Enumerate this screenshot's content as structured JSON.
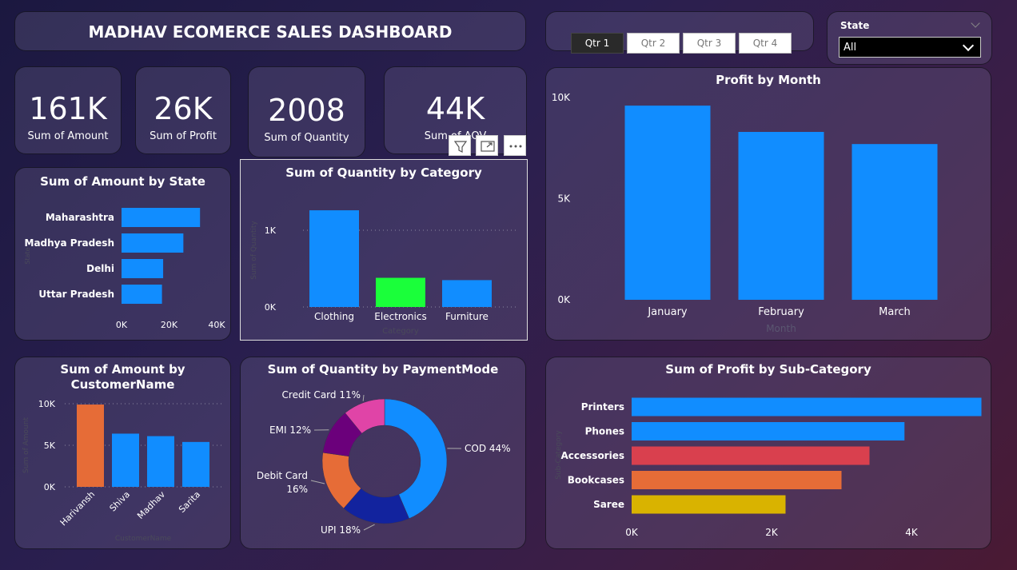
{
  "header": {
    "title": "MADHAV ECOMERCE SALES DASHBOARD"
  },
  "quarters": {
    "items": [
      "Qtr 1",
      "Qtr 2",
      "Qtr 3",
      "Qtr 4"
    ],
    "selected": "Qtr 1"
  },
  "state_filter": {
    "label": "State",
    "value": "All"
  },
  "kpis": [
    {
      "value": "161K",
      "label": "Sum of Amount"
    },
    {
      "value": "26K",
      "label": "Sum of Profit"
    },
    {
      "value": "2008",
      "label": "Sum of Quantity"
    },
    {
      "value": "44K",
      "label": "Sum of AOV"
    }
  ],
  "colors": {
    "blue": "#118DFF",
    "green": "#1AFF3A",
    "orange": "#E66C37",
    "red": "#D9404E",
    "yellow": "#D9B300",
    "navy": "#12239E",
    "purple": "#6B007B",
    "pink": "#E044A7"
  },
  "chart_data": [
    {
      "id": "amount_by_state",
      "type": "bar",
      "orientation": "horizontal",
      "title": "Sum of Amount by State",
      "ylabel": "State",
      "xlabel": "",
      "categories": [
        "Maharashtra",
        "Madhya Pradesh",
        "Delhi",
        "Uttar Pradesh"
      ],
      "values": [
        33000,
        26000,
        17500,
        17000
      ],
      "xlim": [
        0,
        40000
      ],
      "xticks": [
        "0K",
        "20K",
        "40K"
      ]
    },
    {
      "id": "quantity_by_category",
      "type": "bar",
      "title": "Sum of Quantity by Category",
      "xlabel": "Category",
      "ylabel": "Sum of Quantity",
      "categories": [
        "Clothing",
        "Electronics",
        "Furniture"
      ],
      "values": [
        1260,
        380,
        350
      ],
      "bar_colors": [
        "#118DFF",
        "#1AFF3A",
        "#118DFF"
      ],
      "ylim": [
        0,
        1000
      ],
      "yticks": [
        "0K",
        "1K"
      ]
    },
    {
      "id": "profit_by_month",
      "type": "bar",
      "title": "Profit by Month",
      "xlabel": "Month",
      "ylabel": "",
      "categories": [
        "January",
        "February",
        "March"
      ],
      "values": [
        9600,
        8300,
        7700
      ],
      "ylim": [
        0,
        10000
      ],
      "yticks": [
        "0K",
        "5K",
        "10K"
      ]
    },
    {
      "id": "amount_by_customer",
      "type": "bar",
      "title_lines": [
        "Sum of Amount by",
        "CustomerName"
      ],
      "xlabel": "CustomerName",
      "ylabel": "Sum of Amount",
      "categories": [
        "Harivansh",
        "Shiva",
        "Madhav",
        "Sarita"
      ],
      "values": [
        9900,
        6400,
        6100,
        5400
      ],
      "bar_colors": [
        "#E66C37",
        "#118DFF",
        "#118DFF",
        "#118DFF"
      ],
      "ylim": [
        0,
        10000
      ],
      "yticks": [
        "0K",
        "5K",
        "10K"
      ]
    },
    {
      "id": "quantity_by_payment",
      "type": "pie",
      "donut": true,
      "title": "Sum of Quantity by PaymentMode",
      "slices": [
        {
          "label": "COD 44%",
          "value": 44,
          "color": "#118DFF"
        },
        {
          "label": "UPI 18%",
          "value": 18,
          "color": "#12239E"
        },
        {
          "label": "Debit Card 16%",
          "label_lines": [
            "Debit Card",
            "16%"
          ],
          "value": 16,
          "color": "#E66C37"
        },
        {
          "label": "EMI 12%",
          "value": 12,
          "color": "#6B007B"
        },
        {
          "label": "Credit Card 11%",
          "value": 11,
          "color": "#E044A7"
        }
      ]
    },
    {
      "id": "profit_by_subcategory",
      "type": "bar",
      "orientation": "horizontal",
      "title": "Sum of Profit by Sub-Category",
      "ylabel": "Sub-Category",
      "xlabel": "",
      "categories": [
        "Printers",
        "Phones",
        "Accessories",
        "Bookcases",
        "Saree"
      ],
      "values": [
        5000,
        3900,
        3400,
        3000,
        2200
      ],
      "bar_colors": [
        "#118DFF",
        "#118DFF",
        "#D9404E",
        "#E66C37",
        "#D9B300"
      ],
      "xlim": [
        0,
        4000
      ],
      "xticks": [
        "0K",
        "2K",
        "4K"
      ]
    }
  ]
}
